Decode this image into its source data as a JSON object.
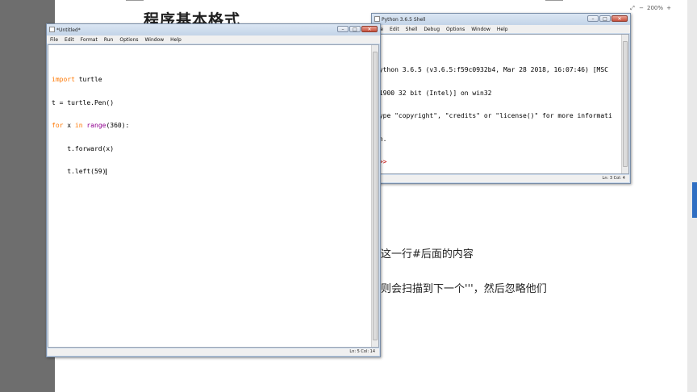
{
  "document": {
    "heading": "程序基本格式",
    "line1": "这一行#后面的内容",
    "line2": "则会扫描到下一个'''，然后忽略他们"
  },
  "zoom": {
    "zoom_in": "+",
    "zoom_out": "−",
    "level": "200%",
    "fit": "⤢",
    "minimize": "−",
    "restore": "□",
    "close": "×"
  },
  "editor_window": {
    "title": "*Untitled*",
    "menu": [
      "File",
      "Edit",
      "Format",
      "Run",
      "Options",
      "Window",
      "Help"
    ],
    "code": [
      {
        "kw": "import",
        "rest": " turtle"
      },
      {
        "kw": "",
        "rest": "t = turtle.Pen()"
      },
      {
        "kw": "for",
        "rest": " x ",
        "kw2": "in",
        "bi": " range",
        "rest2": "(360):"
      },
      {
        "kw": "",
        "rest": "    t.forward(x)"
      },
      {
        "kw": "",
        "rest": "    t.left(59)"
      }
    ],
    "status": "Ln: 5   Col: 14",
    "icon": "python-file-icon"
  },
  "shell_window": {
    "title": "Python 3.6.5 Shell",
    "menu": [
      "File",
      "Edit",
      "Shell",
      "Debug",
      "Options",
      "Window",
      "Help"
    ],
    "output": [
      "Python 3.6.5 (v3.6.5:f59c0932b4, Mar 28 2018, 16:07:46) [MSC",
      " 1900 32 bit (Intel)] on win32",
      "Type \"copyright\", \"credits\" or \"license()\" for more informati",
      "on.",
      ">>> "
    ],
    "status": "Ln: 3   Col: 4",
    "icon": "python-shell-icon"
  },
  "window_controls": {
    "minimize": "–",
    "maximize": "□",
    "close": "✕"
  },
  "colors": {
    "keyword": "#ff7700",
    "builtin": "#900090",
    "prompt": "#c00000"
  }
}
